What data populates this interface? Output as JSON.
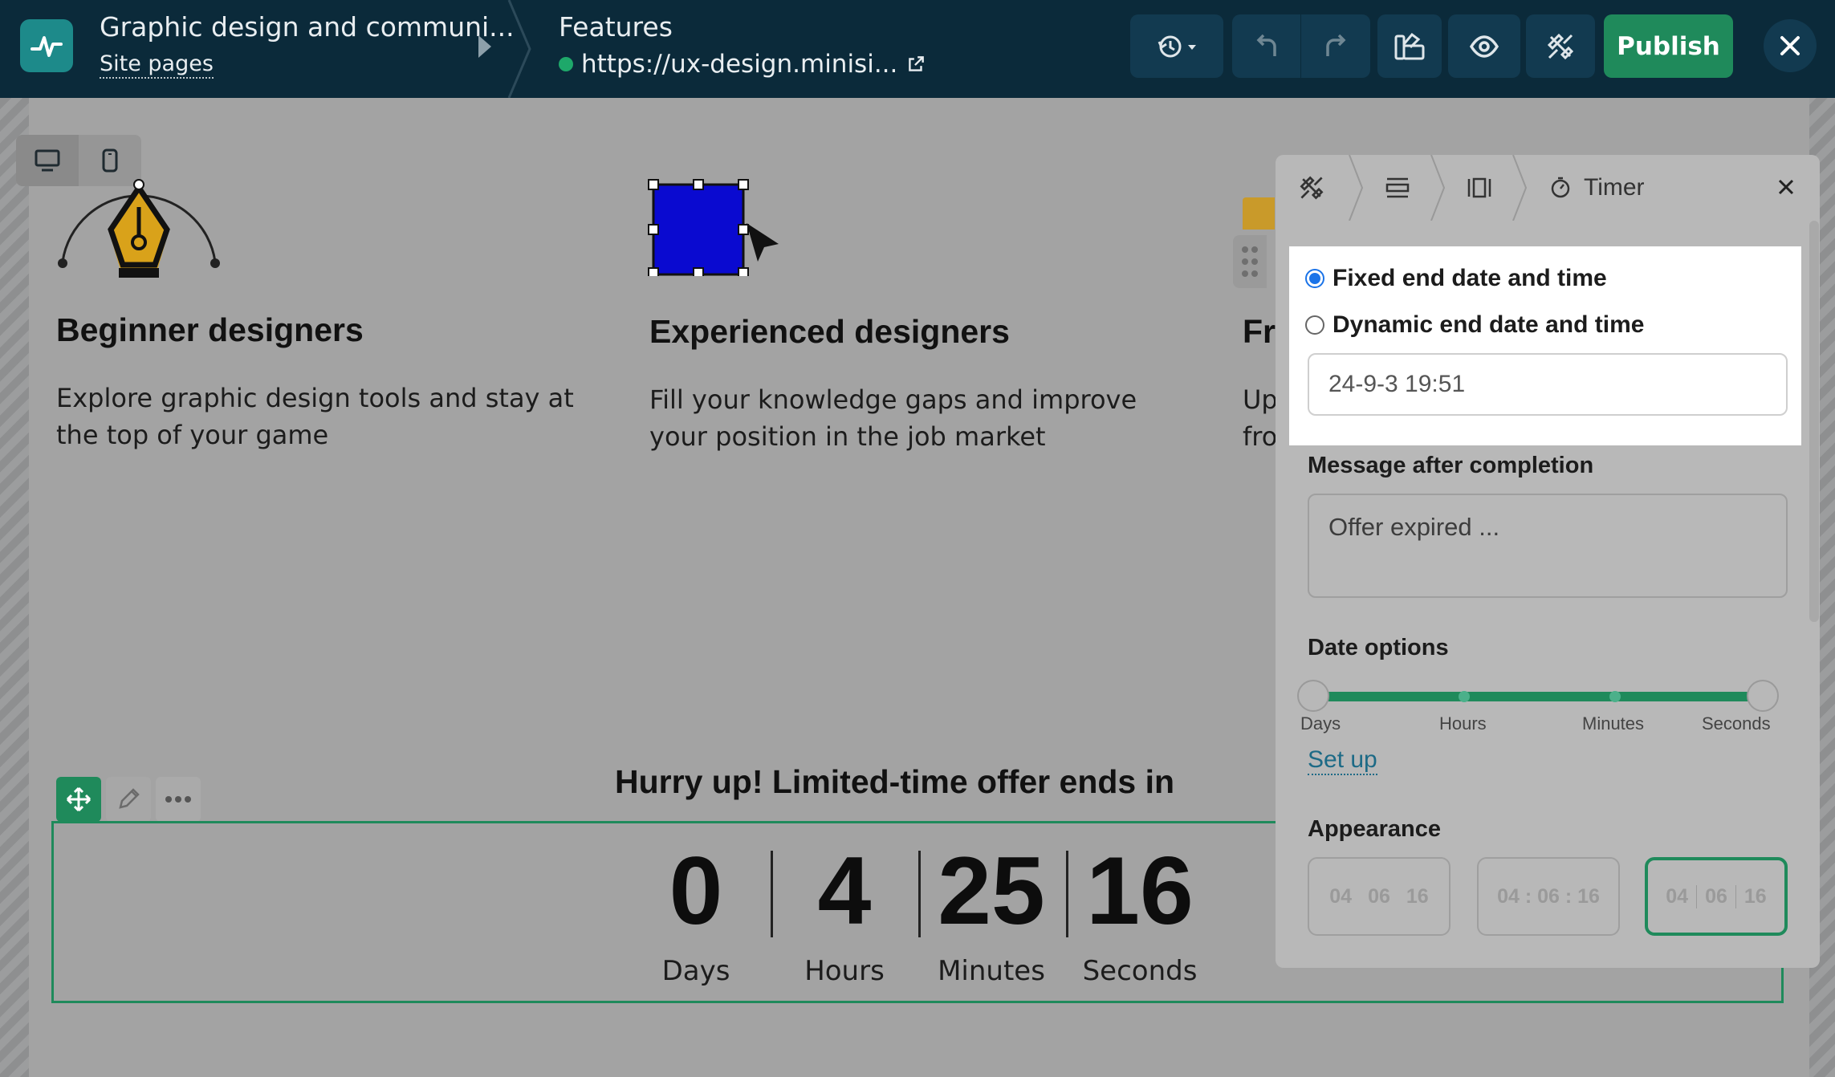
{
  "topbar": {
    "site_title": "Graphic design and communi...",
    "site_pages_link": "Site pages",
    "page_name": "Features",
    "page_url": "https://ux-design.minisi...",
    "publish_label": "Publish",
    "accent_color": "#1f8a5b",
    "bg_color": "#0b2a3a",
    "icons": [
      "logo-icon",
      "history-icon",
      "undo-icon",
      "redo-icon",
      "style-icon",
      "preview-icon",
      "settings-icon",
      "close-icon"
    ]
  },
  "device_toggle": {
    "icons": [
      "desktop-icon",
      "mobile-icon"
    ]
  },
  "features": [
    {
      "title": "Beginner designers",
      "text": "Explore graphic design tools and stay at the top of your game",
      "icon": "pen-tool-icon"
    },
    {
      "title": "Experienced designers",
      "text": "Fill your knowledge gaps and improve your position in the job market",
      "icon": "selection-box-icon"
    },
    {
      "title": "Fr",
      "text": "Up fro",
      "icon": "partial-icon"
    }
  ],
  "timer": {
    "heading": "Hurry up! Limited-time offer ends in",
    "units": [
      {
        "value": "0",
        "label": "Days"
      },
      {
        "value": "4",
        "label": "Hours"
      },
      {
        "value": "25",
        "label": "Minutes"
      },
      {
        "value": "16",
        "label": "Seconds"
      }
    ],
    "tool_icons": [
      "move-icon",
      "edit-icon",
      "more-icon"
    ]
  },
  "panel": {
    "title": "Timer",
    "tab_icons": [
      "design-icon",
      "layout-icon",
      "spacing-icon",
      "timer-icon"
    ],
    "radio_fixed": "Fixed end date and time",
    "radio_dynamic": "Dynamic end date and time",
    "selected_mode": "Fixed end date and time",
    "date_value": "24-9-3 19:51",
    "message_label": "Message after completion",
    "message_placeholder": "Offer expired ...",
    "date_options_label": "Date options",
    "date_options": [
      "Days",
      "Hours",
      "Minutes",
      "Seconds"
    ],
    "set_up_link": "Set up",
    "appearance_label": "Appearance",
    "appearance_options": [
      {
        "segments": [
          "04",
          "06",
          "16"
        ],
        "style": "plain"
      },
      {
        "segments": [
          "04 : 06 : 16"
        ],
        "style": "colons"
      },
      {
        "segments": [
          "04",
          "06",
          "16"
        ],
        "style": "dividers",
        "selected": true
      }
    ]
  }
}
